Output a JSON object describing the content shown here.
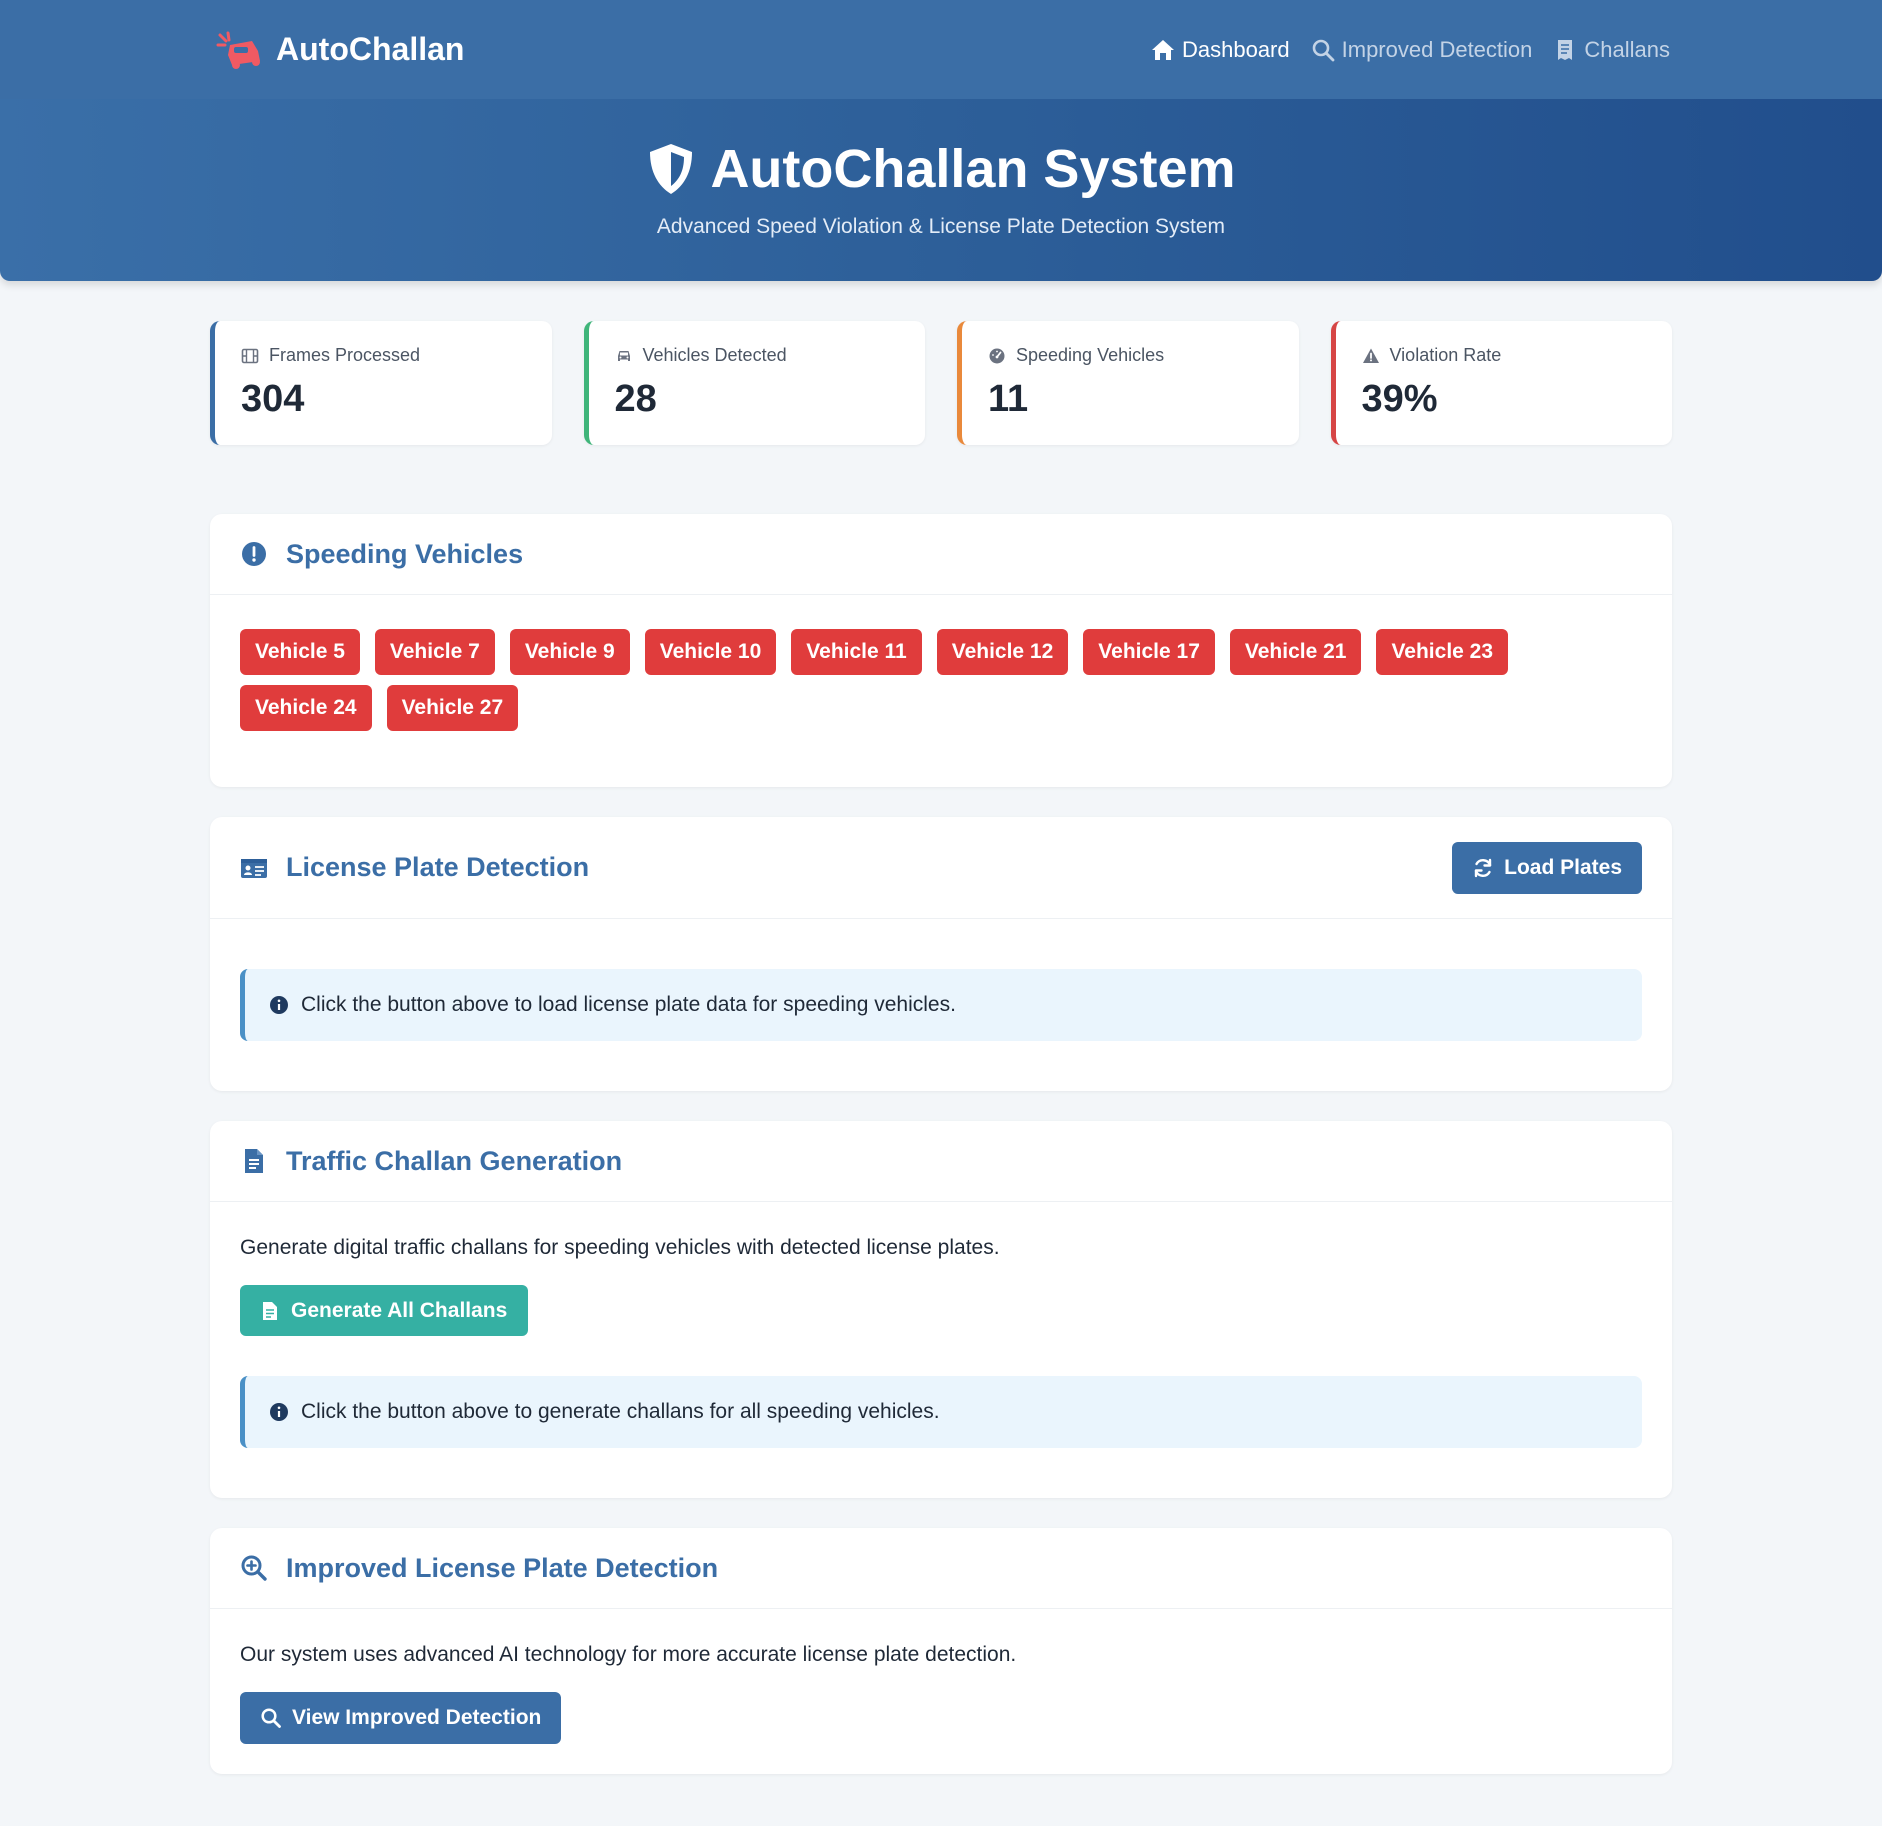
{
  "nav": {
    "brand": "AutoChallan",
    "links": [
      {
        "label": "Dashboard",
        "icon": "home-icon",
        "active": true
      },
      {
        "label": "Improved Detection",
        "icon": "search-icon",
        "active": false
      },
      {
        "label": "Challans",
        "icon": "receipt-icon",
        "active": false
      }
    ]
  },
  "hero": {
    "title": "AutoChallan System",
    "subtitle": "Advanced Speed Violation & License Plate Detection System"
  },
  "stats": [
    {
      "label": "Frames Processed",
      "value": "304",
      "icon": "film-icon",
      "color": "#3b6ea6"
    },
    {
      "label": "Vehicles Detected",
      "value": "28",
      "icon": "car-icon",
      "color": "#3fb57a"
    },
    {
      "label": "Speeding Vehicles",
      "value": "11",
      "icon": "speedometer-icon",
      "color": "#e9893b"
    },
    {
      "label": "Violation Rate",
      "value": "39%",
      "icon": "warning-icon",
      "color": "#d64545"
    }
  ],
  "speeding": {
    "title": "Speeding Vehicles",
    "vehicles": [
      "Vehicle 5",
      "Vehicle 7",
      "Vehicle 9",
      "Vehicle 10",
      "Vehicle 11",
      "Vehicle 12",
      "Vehicle 17",
      "Vehicle 21",
      "Vehicle 23",
      "Vehicle 24",
      "Vehicle 27"
    ]
  },
  "plates": {
    "title": "License Plate Detection",
    "button": "Load Plates",
    "info": "Click the button above to load license plate data for speeding vehicles."
  },
  "challan": {
    "title": "Traffic Challan Generation",
    "description": "Generate digital traffic challans for speeding vehicles with detected license plates.",
    "button": "Generate All Challans",
    "info": "Click the button above to generate challans for all speeding vehicles."
  },
  "improved": {
    "title": "Improved License Plate Detection",
    "description": "Our system uses advanced AI technology for more accurate license plate detection.",
    "button": "View Improved Detection"
  },
  "colors": {
    "primary": "#3b6ea6",
    "danger": "#e03c3c",
    "teal": "#35b0a3",
    "background": "#f3f6f9"
  }
}
